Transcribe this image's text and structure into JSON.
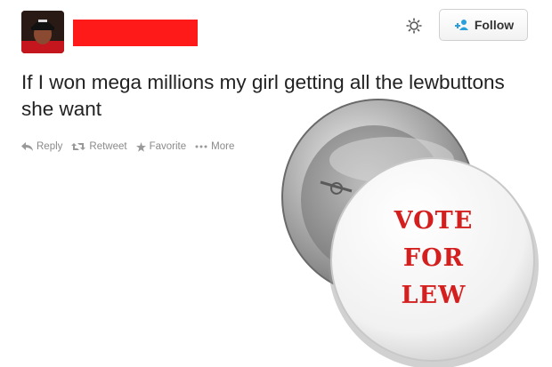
{
  "tweet": {
    "text": "If I won mega millions my girl getting all the lewbuttons she want",
    "follow_label": "Follow",
    "actions": [
      {
        "label": "Reply",
        "icon": "reply-icon"
      },
      {
        "label": "Retweet",
        "icon": "retweet-icon"
      },
      {
        "label": "Favorite",
        "icon": "star-icon"
      },
      {
        "label": "More",
        "icon": "more-dots-icon"
      }
    ]
  },
  "button_image": {
    "lines": [
      "VOTE",
      "FOR",
      "LEW"
    ],
    "text_color": "#d41f1f"
  },
  "colors": {
    "redaction": "#ff1a1a",
    "follow_accent": "#2b9fd9",
    "action_text": "#8a8a8a"
  }
}
